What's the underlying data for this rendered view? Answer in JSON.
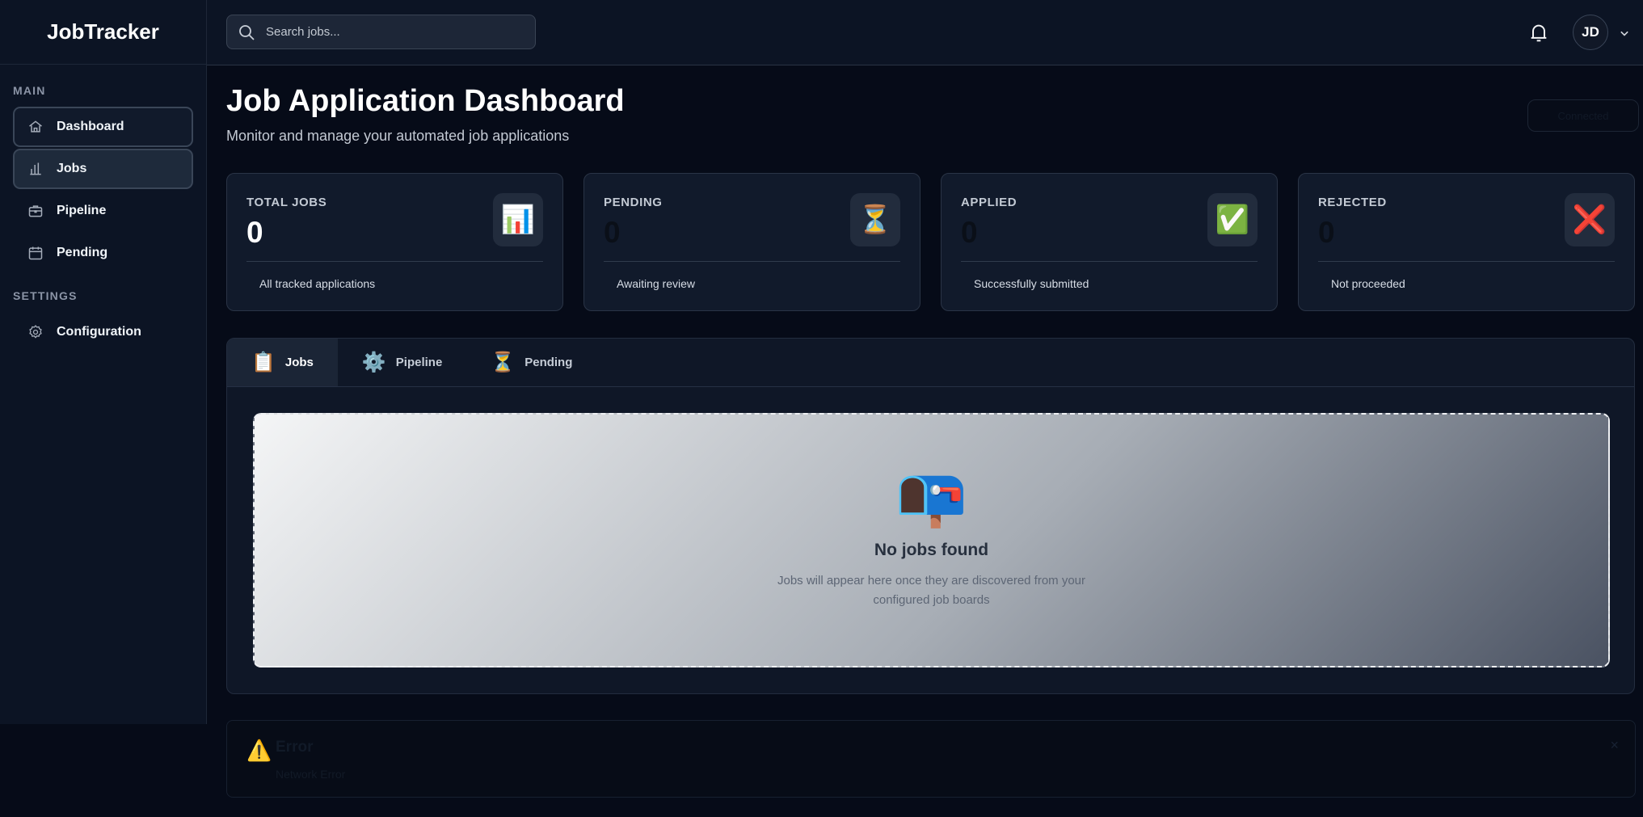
{
  "app": {
    "name": "JobTracker"
  },
  "sidebar": {
    "main_heading": "MAIN",
    "settings_heading": "SETTINGS",
    "items": [
      {
        "label": "Dashboard",
        "icon": "home-icon"
      },
      {
        "label": "Jobs",
        "icon": "bar-chart-icon"
      },
      {
        "label": "Pipeline",
        "icon": "briefcase-icon"
      },
      {
        "label": "Pending",
        "icon": "calendar-icon"
      }
    ],
    "settings_items": [
      {
        "label": "Configuration",
        "icon": "gear-icon"
      }
    ]
  },
  "header": {
    "search_placeholder": "Search jobs...",
    "user_initials": "JD"
  },
  "page": {
    "title": "Job Application Dashboard",
    "subtitle": "Monitor and manage your automated job applications",
    "connection_status": "Connected"
  },
  "stats": [
    {
      "label": "TOTAL JOBS",
      "value": "0",
      "description": "All tracked applications",
      "emoji": "📊"
    },
    {
      "label": "PENDING",
      "value": "0",
      "description": "Awaiting review",
      "emoji": "⏳"
    },
    {
      "label": "APPLIED",
      "value": "0",
      "description": "Successfully submitted",
      "emoji": "✅"
    },
    {
      "label": "REJECTED",
      "value": "0",
      "description": "Not proceeded",
      "emoji": "❌"
    }
  ],
  "tabs": [
    {
      "label": "Jobs",
      "emoji": "📋"
    },
    {
      "label": "Pipeline",
      "emoji": "⚙️"
    },
    {
      "label": "Pending",
      "emoji": "⏳"
    }
  ],
  "empty_state": {
    "emoji": "📭",
    "title": "No jobs found",
    "text": "Jobs will appear here once they are discovered from your configured job boards"
  },
  "error": {
    "emoji": "⚠️",
    "title": "Error",
    "message": "Network Error",
    "close_symbol": "×"
  },
  "colors": {
    "page_background": "#060b18",
    "sidebar_background": "#0c1424",
    "card_background": "#111a2b",
    "accent_red": "#e11d2e"
  }
}
